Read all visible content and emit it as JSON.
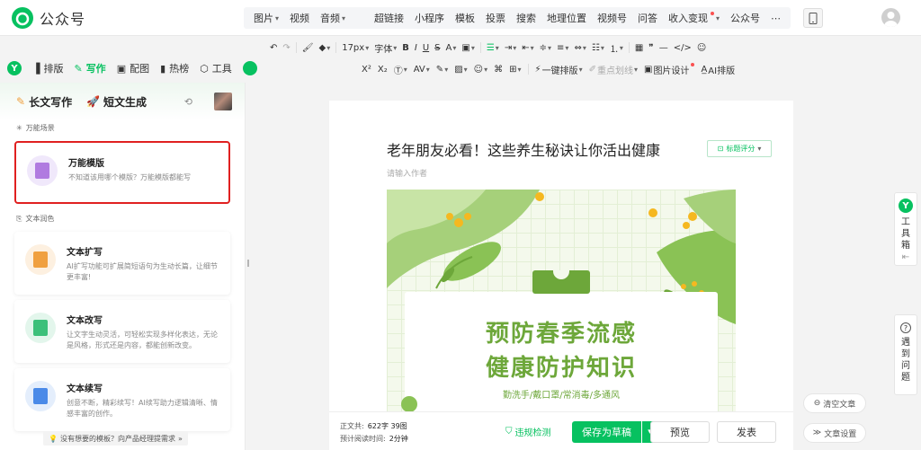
{
  "app": {
    "title": "公众号"
  },
  "top_menu": {
    "group1": [
      {
        "label": "图片",
        "caret": true
      },
      {
        "label": "视频",
        "caret": false
      },
      {
        "label": "音频",
        "caret": true
      }
    ],
    "group2": [
      {
        "label": "超链接"
      },
      {
        "label": "小程序"
      },
      {
        "label": "模板"
      },
      {
        "label": "投票"
      },
      {
        "label": "搜索"
      },
      {
        "label": "地理位置"
      },
      {
        "label": "视频号"
      },
      {
        "label": "问答"
      },
      {
        "label": "收入变现",
        "caret": true,
        "dot": true
      },
      {
        "label": "公众号"
      },
      {
        "label": "⋯"
      }
    ]
  },
  "format_toolbar": {
    "font_size": "17px",
    "font_family": "字体",
    "one_click_layout": "一键排版",
    "key_points": "重点划线",
    "image_design": "图片设计",
    "ai_layout": "AI排版"
  },
  "assistant": {
    "tabs": [
      {
        "label": "排版",
        "icon": "layout-icon",
        "active": false
      },
      {
        "label": "写作",
        "icon": "write-icon",
        "active": true
      },
      {
        "label": "配图",
        "icon": "image-icon",
        "active": false
      },
      {
        "label": "热榜",
        "icon": "hotlist-icon",
        "active": false
      },
      {
        "label": "工具",
        "icon": "tool-icon",
        "active": false
      }
    ]
  },
  "left_panel": {
    "long_write": "长文写作",
    "short_gen": "短文生成",
    "section_universal": "万能场景",
    "section_polish": "文本润色",
    "cards": [
      {
        "title": "万能模版",
        "desc": "不知道该用哪个模版？万能模版都能写",
        "color": "#b07be0",
        "bg": "#f0e8fb"
      },
      {
        "title": "文本扩写",
        "desc": "AI扩写功能可扩展简短语句为生动长篇，让细节更丰富!",
        "color": "#f0a040",
        "bg": "#fdf0e0"
      },
      {
        "title": "文本改写",
        "desc": "让文字生动灵活，可轻松实现多样化表达，无论是风格，形式还是内容，都能创新改变。",
        "color": "#3cc07a",
        "bg": "#e3f6ec"
      },
      {
        "title": "文本续写",
        "desc": "创意不断，精彩续写！AI续写助力逻辑清晰、情感丰富的创作。",
        "color": "#4a8ae8",
        "bg": "#e4eefc"
      }
    ],
    "feedback": "没有想要的模板？向产品经理提需求"
  },
  "editor": {
    "title": "老年朋友必看！这些养生秘诀让你活出健康",
    "author_placeholder": "请输入作者",
    "score_label": "标题评分",
    "cover": {
      "line1": "预防春季流感",
      "line2": "健康防护知识",
      "slogan": "勤洗手/戴口罩/常消毒/多通风",
      "accent": "#6da73a"
    }
  },
  "side_tools": {
    "toolbox": [
      "工",
      "具",
      "箱"
    ],
    "help": [
      "遇",
      "到",
      "问",
      "题"
    ],
    "clear": "清空文章",
    "settings": "文章设置"
  },
  "bottom_bar": {
    "words_label": "正文共:",
    "words_value": "622字 39图",
    "read_label": "预计阅读时间:",
    "read_value": "2分钟",
    "violation": "违规检测",
    "save": "保存为草稿",
    "preview": "预览",
    "publish": "发表"
  }
}
